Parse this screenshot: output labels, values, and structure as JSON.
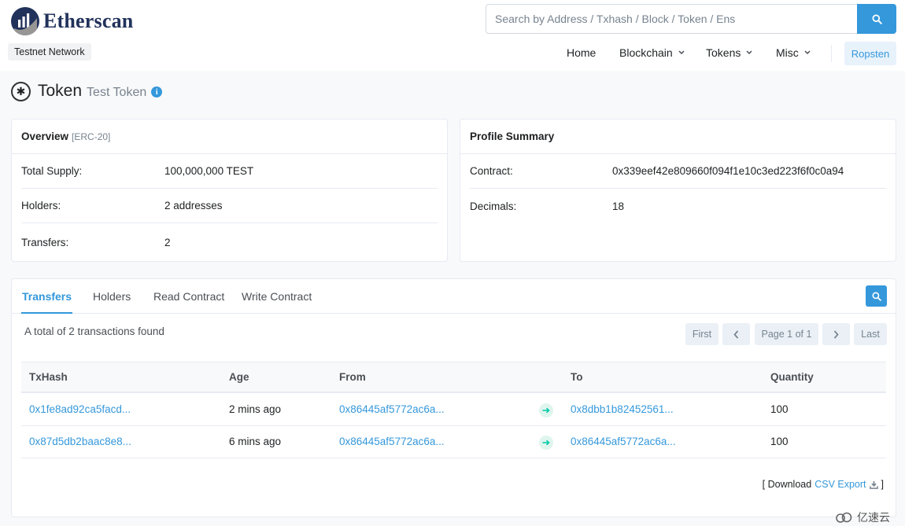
{
  "brand": {
    "name": "Etherscan",
    "network_badge": "Testnet Network"
  },
  "search": {
    "placeholder": "Search by Address / Txhash / Block / Token / Ens"
  },
  "nav": {
    "home": "Home",
    "blockchain": "Blockchain",
    "tokens": "Tokens",
    "misc": "Misc",
    "network": "Ropsten"
  },
  "page": {
    "title": "Token",
    "subtitle": "Test Token"
  },
  "overview": {
    "header": "Overview",
    "standard": "[ERC-20]",
    "total_supply_label": "Total Supply:",
    "total_supply_value": "100,000,000 TEST",
    "holders_label": "Holders:",
    "holders_value": "2 addresses",
    "transfers_label": "Transfers:",
    "transfers_value": "2"
  },
  "profile": {
    "header": "Profile Summary",
    "contract_label": "Contract:",
    "contract_value": "0x339eef42e809660f094f1e10c3ed223f6f0c0a94",
    "decimals_label": "Decimals:",
    "decimals_value": "18"
  },
  "tabs": {
    "transfers": "Transfers",
    "holders": "Holders",
    "read_contract": "Read Contract",
    "write_contract": "Write Contract"
  },
  "transfers": {
    "total_text": "A total of 2 transactions found",
    "pagination": {
      "first": "First",
      "page_info": "Page 1 of 1",
      "last": "Last"
    },
    "columns": {
      "txhash": "TxHash",
      "age": "Age",
      "from": "From",
      "to": "To",
      "quantity": "Quantity"
    },
    "rows": [
      {
        "txhash": "0x1fe8ad92ca5facd...",
        "age": "2 mins ago",
        "from": "0x86445af5772ac6a...",
        "to": "0x8dbb1b82452561...",
        "quantity": "100"
      },
      {
        "txhash": "0x87d5db2baac8e8...",
        "age": "6 mins ago",
        "from": "0x86445af5772ac6a...",
        "to": "0x86445af5772ac6a...",
        "quantity": "100"
      }
    ],
    "download": {
      "prefix": "[ Download",
      "link": "CSV Export",
      "suffix": "]"
    }
  },
  "watermark": "亿速云",
  "colors": {
    "accent": "#3498db",
    "brand": "#21325b",
    "arrow": "#00c9a7"
  }
}
